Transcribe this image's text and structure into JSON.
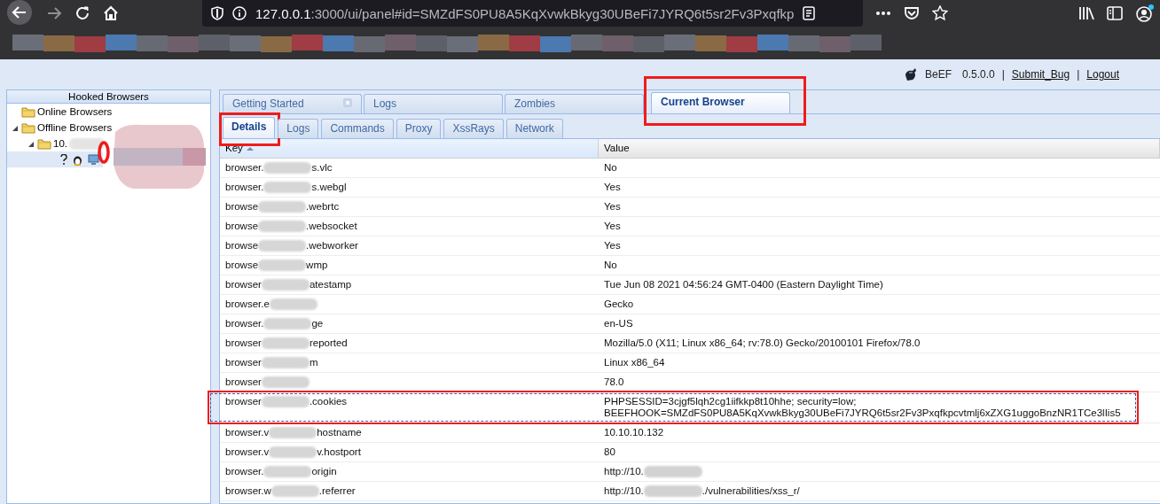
{
  "browser_toolbar": {
    "url_host": "127.0.0.1",
    "url_rest": ":3000/ui/panel#id=SMZdFS0PU8A5KqXvwkBkyg30UBeFi7JYRQ6t5sr2Fv3Pxqfkp"
  },
  "header": {
    "product": "BeEF",
    "version": "0.5.0.0",
    "items": [
      {
        "kind": "separator",
        "text": "|"
      },
      {
        "kind": "link",
        "text": "Submit_Bug"
      },
      {
        "kind": "separator",
        "text": "|"
      },
      {
        "kind": "link",
        "text": "Logout"
      }
    ]
  },
  "hooked_browsers": {
    "title": "Hooked Browsers",
    "tree": [
      {
        "label": "Online Browsers"
      },
      {
        "label": "Offline Browsers",
        "expanded": true,
        "children": [
          {
            "label": "10.",
            "expanded": true,
            "children": [
              {
                "kind": "browser",
                "selected": true
              }
            ]
          }
        ]
      }
    ]
  },
  "tabs": [
    {
      "label": "Getting Started",
      "selected": false,
      "closable": true,
      "annotated": false
    },
    {
      "label": "Logs",
      "selected": false,
      "closable": false,
      "annotated": false
    },
    {
      "label": "Zombies",
      "selected": false,
      "closable": false,
      "annotated": false
    },
    {
      "label": "Current Browser",
      "selected": true,
      "closable": false,
      "annotated": true
    }
  ],
  "subtabs": [
    {
      "label": "Details",
      "selected": true,
      "annotated": true
    },
    {
      "label": "Logs",
      "selected": false,
      "annotated": false
    },
    {
      "label": "Commands",
      "selected": false,
      "annotated": false
    },
    {
      "label": "Proxy",
      "selected": false,
      "annotated": false
    },
    {
      "label": "XssRays",
      "selected": false,
      "annotated": false
    },
    {
      "label": "Network",
      "selected": false,
      "annotated": false
    }
  ],
  "table": {
    "columns": [
      {
        "label": "Key",
        "sorted": true
      },
      {
        "label": "Value",
        "sorted": false
      }
    ],
    "rows": [
      {
        "key_start": "browser.",
        "key_end": "s.vlc",
        "value": "No",
        "annotated": false
      },
      {
        "key_start": "browser.",
        "key_end": "s.webgl",
        "value": "Yes",
        "annotated": false
      },
      {
        "key_start": "browse",
        "key_end": ".webrtc",
        "value": "Yes",
        "annotated": false
      },
      {
        "key_start": "browse",
        "key_end": ".websocket",
        "value": "Yes",
        "annotated": false
      },
      {
        "key_start": "browse",
        "key_end": ".webworker",
        "value": "Yes",
        "annotated": false
      },
      {
        "key_start": "browse",
        "key_end": "wmp",
        "value": "No",
        "annotated": false
      },
      {
        "key_start": "browser",
        "key_end": "atestamp",
        "value": "Tue Jun 08 2021 04:56:24 GMT-0400 (Eastern Daylight Time)",
        "annotated": false
      },
      {
        "key_start": "browser.e",
        "value": "Gecko",
        "annotated": false
      },
      {
        "key_start": "browser.",
        "key_end": "ge",
        "value": "en-US",
        "annotated": false
      },
      {
        "key_start": "browser",
        "key_end": "reported",
        "value": "Mozilla/5.0 (X11; Linux x86_64; rv:78.0) Gecko/20100101 Firefox/78.0",
        "annotated": false
      },
      {
        "key_start": "browser",
        "key_end": "m",
        "value": "Linux x86_64",
        "annotated": false
      },
      {
        "key_start": "browser",
        "value": "78.0",
        "annotated": false
      },
      {
        "key_start": "browser",
        "key_end": ".cookies",
        "value_lines": [
          "PHPSESSID=3cjgf5lqh2cg1iifkkp8t10hhe; security=low;",
          "BEEFHOOK=SMZdFS0PU8A5KqXvwkBkyg30UBeFi7JYRQ6t5sr2Fv3Pxqfkpcvtmlj6xZXG1uggoBnzNR1TCe3lIis5"
        ],
        "annotated": true
      },
      {
        "key_start": "browser.v",
        "key_end": "hostname",
        "value": "10.10.10.132",
        "annotated": false
      },
      {
        "key_start": "browser.v",
        "key_end": "v.hostport",
        "value": "80",
        "annotated": false
      },
      {
        "key_start": "browser.",
        "key_end": "origin",
        "value_start": "http://10.",
        "annotated": false
      },
      {
        "key_start": "browser.w",
        "key_end": ".referrer",
        "value_start": "http://10.",
        "value_end": "./vulnerabilities/xss_r/",
        "annotated": false
      }
    ]
  }
}
